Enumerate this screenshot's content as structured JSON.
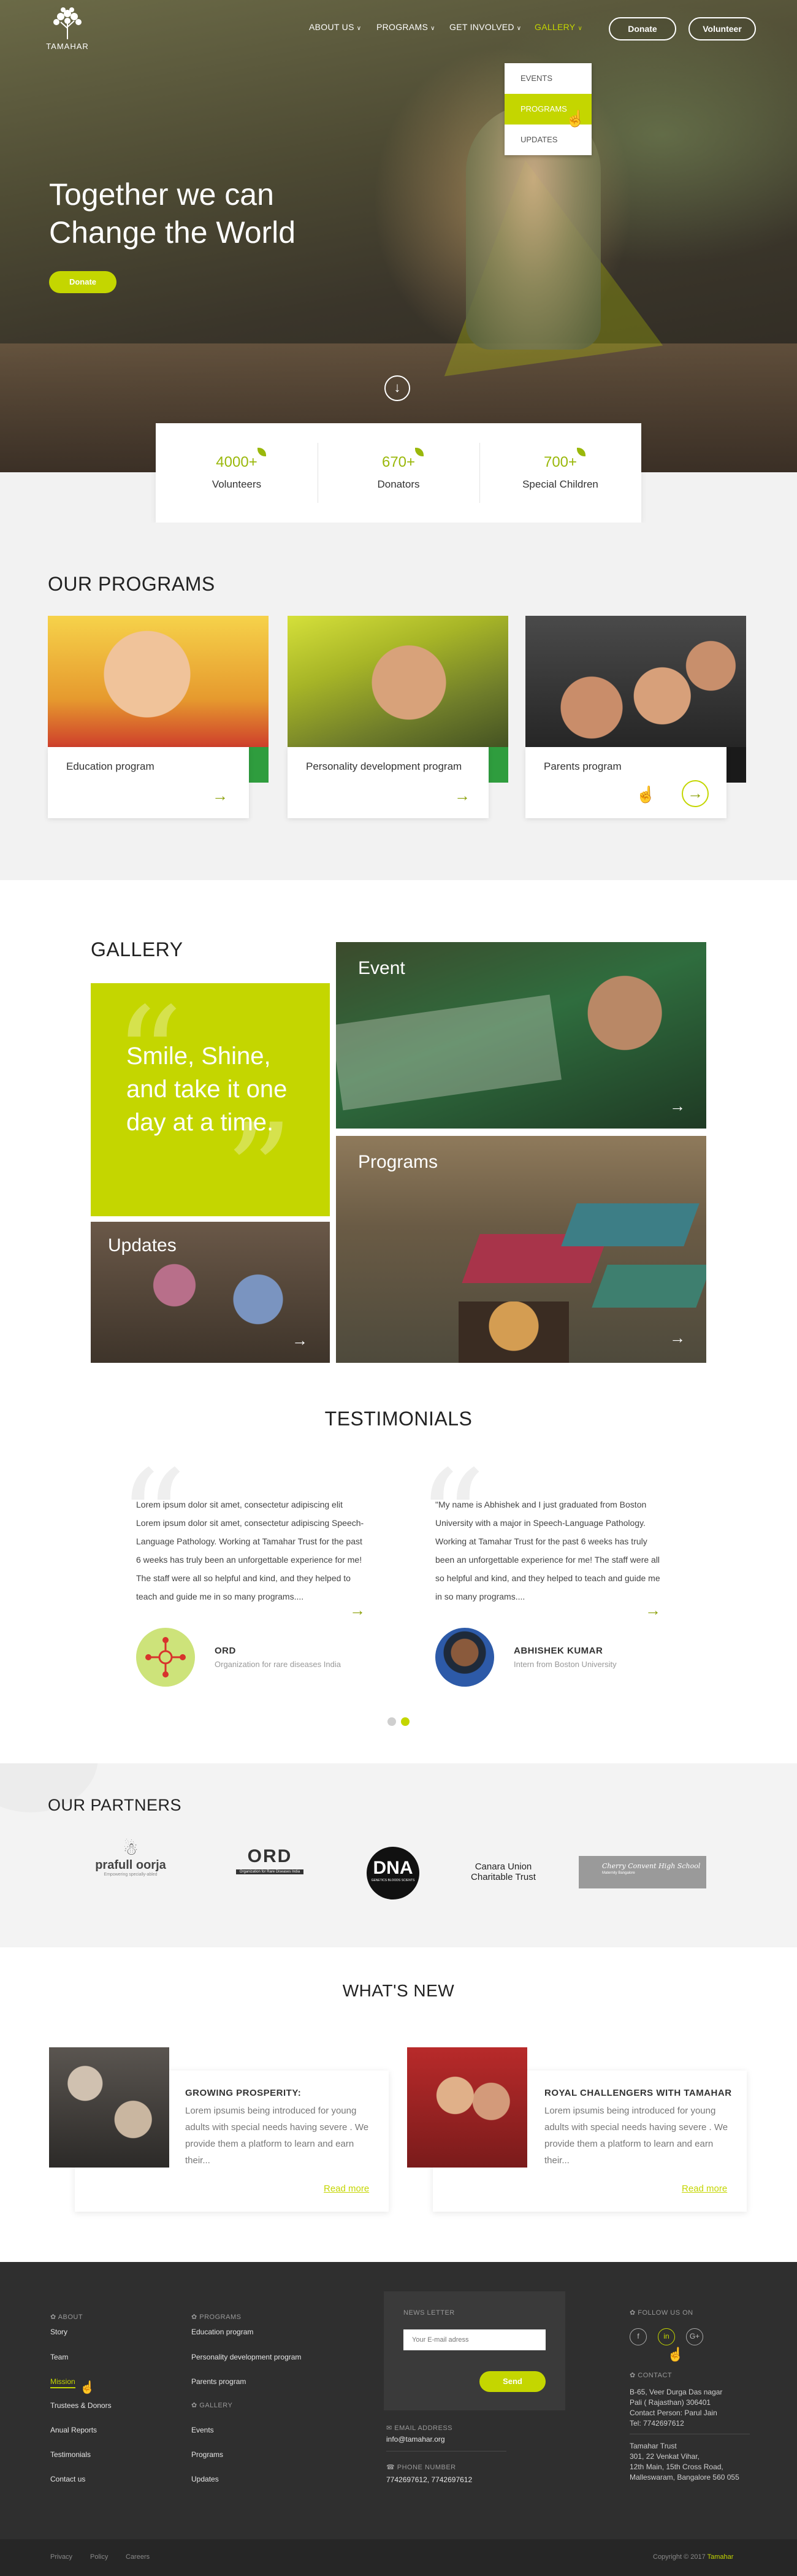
{
  "brand": {
    "name": "TAMAHAR",
    "accent": "#c4d600"
  },
  "nav": {
    "items": [
      {
        "label": "ABOUT US",
        "dropdown": true,
        "active": false
      },
      {
        "label": "PROGRAMS",
        "dropdown": true,
        "active": false
      },
      {
        "label": "GET INVOLVED",
        "dropdown": true,
        "active": false
      },
      {
        "label": "GALLERY",
        "dropdown": true,
        "active": true
      }
    ],
    "donate_label": "Donate",
    "volunteer_label": "Volunteer",
    "gallery_menu": [
      {
        "label": "EVENTS",
        "active": false
      },
      {
        "label": "PROGRAMS",
        "active": true
      },
      {
        "label": "UPDATES",
        "active": false
      }
    ]
  },
  "hero": {
    "title_line1": "Together we can",
    "title_line2": "Change the World",
    "donate_label": "Donate",
    "scroll_icon": "arrow-down-circle-icon"
  },
  "stats": [
    {
      "value": "4000+",
      "label": "Volunteers"
    },
    {
      "value": "670+",
      "label": "Donators"
    },
    {
      "value": "700+",
      "label": "Special Children"
    }
  ],
  "programs": {
    "title": "OUR PROGRAMS",
    "items": [
      {
        "label": "Education program",
        "color": "#d8332c"
      },
      {
        "label": "Personality development program",
        "color": "#2f9d3e"
      },
      {
        "label": "Parents program",
        "color": "#1a1a1a"
      }
    ]
  },
  "gallery": {
    "title": "GALLERY",
    "quote": "Smile, Shine, and take it one day at a time.",
    "tiles": {
      "event": "Event",
      "programs": "Programs",
      "updates": "Updates"
    }
  },
  "testimonials": {
    "title": "TESTIMONIALS",
    "items": [
      {
        "text": "Lorem ipsum dolor sit amet, consectetur adipiscing elit  Lorem ipsum dolor sit amet, consectetur adipiscing Speech-Language Pathology. Working at Tamahar Trust for the past 6 weeks has truly been an unforgettable experience for me! The staff were all so helpful and kind, and they helped to teach and guide me in so many programs....",
        "name": "ORD",
        "role": "Organization for rare diseases India"
      },
      {
        "text": "\"My name is Abhishek and I just graduated from Boston University with a major in Speech-Language Pathology. Working at Tamahar Trust for the past 6 weeks has truly been an unforgettable experience for me! The staff were all so helpful and kind, and they helped to teach and guide me in so many programs....",
        "name": "ABHISHEK KUMAR",
        "role": "Intern from Boston University"
      }
    ],
    "pagination": {
      "count": 2,
      "active": 2
    }
  },
  "partners": {
    "title": "OUR PARTNERS",
    "logos": [
      {
        "name": "prafull oorja",
        "tagline": "Empowering specially-abled"
      },
      {
        "name": "ORD",
        "tagline": "Organization for Rare Diseases India"
      },
      {
        "name": "DNA",
        "tagline": "GENETICS BLOODS SCIENTS"
      },
      {
        "name": "Canara Union",
        "line2": "Charitable Trust"
      },
      {
        "name": "Cherry Convent High School",
        "tagline": "Maternity Bangalore"
      }
    ]
  },
  "whats_new": {
    "title": "WHAT'S NEW",
    "items": [
      {
        "title": "GROWING PROSPERITY:",
        "text": "Lorem ipsumis being introduced for young adults with special needs having severe . We provide them a platform to learn and earn their...",
        "read_more": "Read more"
      },
      {
        "title": "ROYAL CHALLENGERS WITH TAMAHAR",
        "text": "Lorem ipsumis being introduced for young adults with special needs having severe . We provide them a platform to learn and earn their...",
        "read_more": "Read more"
      }
    ]
  },
  "footer": {
    "about": {
      "head": "ABOUT",
      "links": [
        "Story",
        "Team",
        "Mission",
        "Trustees & Donors",
        "Anual Reports",
        "Testimonials",
        "Contact us"
      ],
      "active_index": 2
    },
    "programs": {
      "head": "PROGRAMS",
      "links": [
        "Education program",
        "Personality development program",
        "Parents program"
      ]
    },
    "gallery": {
      "head": "GALLERY",
      "links": [
        "Events",
        "Programs",
        "Updates"
      ]
    },
    "newsletter": {
      "head": "NEWS LETTER",
      "placeholder": "Your E-mail adress",
      "send_label": "Send"
    },
    "email": {
      "head": "EMAIL ADDRESS",
      "value": "info@tamahar.org"
    },
    "phone": {
      "head": "PHONE NUMBER",
      "value": "7742697612,  7742697612"
    },
    "follow": {
      "head": "FOLLOW US ON",
      "icons": [
        "f",
        "in",
        "G+"
      ]
    },
    "contact": {
      "head": "CONTACT",
      "address1": [
        "B-65, Veer Durga Das nagar",
        "Pali ( Rajasthan) 306401",
        "Contact Person: Parul Jain",
        "Tel: 7742697612"
      ],
      "address2": [
        "Tamahar Trust",
        "301, 22 Venkat Vihar,",
        "12th Main, 15th Cross Road,",
        "Malleswaram, Bangalore 560 055"
      ]
    },
    "bottom_links": [
      "Privacy",
      "Policy",
      "Careers"
    ],
    "copyright": "Copyright © 2017",
    "copyright_brand": "Tamahar"
  }
}
